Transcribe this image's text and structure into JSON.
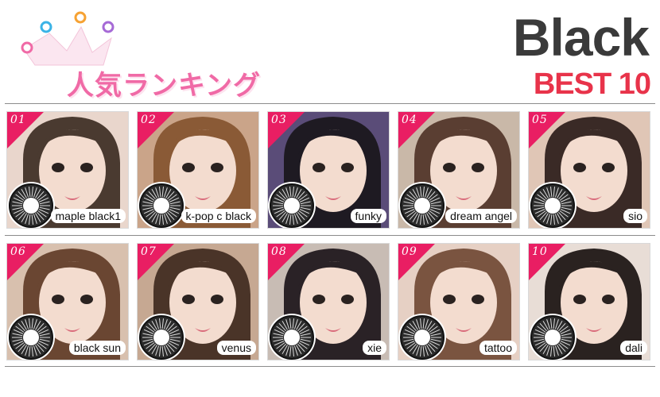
{
  "header": {
    "title_jp": "人気ランキング",
    "title_black": "Black",
    "title_best": "BEST 10",
    "colors": {
      "pink": "#f06aa6",
      "red": "#e8334a",
      "dark": "#3a3a3a",
      "badge": "#e91e63"
    }
  },
  "items": [
    {
      "rank": "01",
      "name": "maple black1",
      "bg": "#e9d6cc",
      "hair": "#4a3a30"
    },
    {
      "rank": "02",
      "name": "k-pop c black",
      "bg": "#caa489",
      "hair": "#8a5a36"
    },
    {
      "rank": "03",
      "name": "funky",
      "bg": "#5a4c78",
      "hair": "#1e1a22"
    },
    {
      "rank": "04",
      "name": "dream angel",
      "bg": "#c9b8a8",
      "hair": "#5a3e32"
    },
    {
      "rank": "05",
      "name": "sio",
      "bg": "#e0c6b6",
      "hair": "#3a2a26"
    },
    {
      "rank": "06",
      "name": "black sun",
      "bg": "#d8c0ae",
      "hair": "#6a4632"
    },
    {
      "rank": "07",
      "name": "venus",
      "bg": "#c6a892",
      "hair": "#4a3428"
    },
    {
      "rank": "08",
      "name": "xie",
      "bg": "#c8bcb4",
      "hair": "#2a2226"
    },
    {
      "rank": "09",
      "name": "tattoo",
      "bg": "#e6d0c4",
      "hair": "#7a5440"
    },
    {
      "rank": "10",
      "name": "dali",
      "bg": "#e8ddd6",
      "hair": "#2a2220"
    }
  ]
}
